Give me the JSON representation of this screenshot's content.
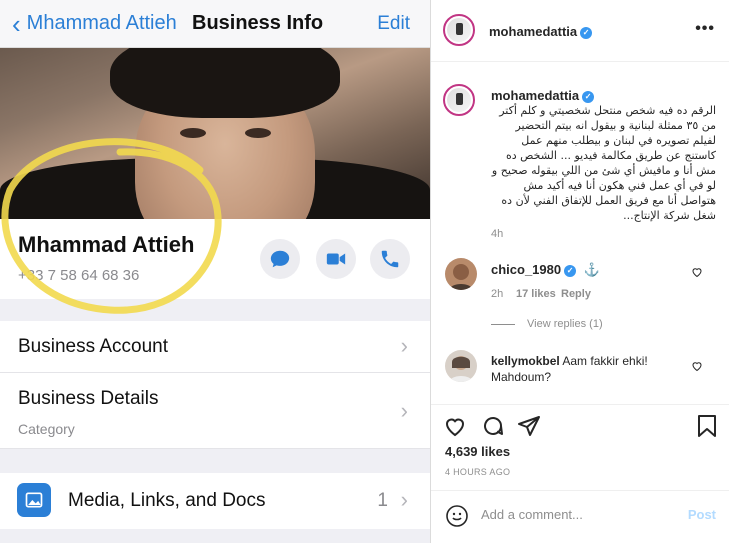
{
  "whatsapp": {
    "nav": {
      "back_label": "Mhammad Attieh",
      "title": "Business Info",
      "edit_label": "Edit"
    },
    "contact": {
      "name": "Mhammad Attieh",
      "phone": "+33 7 58 64 68 36"
    },
    "rows": [
      {
        "label": "Business Account"
      },
      {
        "label": "Business Details",
        "sub": "Category"
      }
    ],
    "media": {
      "label": "Media, Links, and Docs",
      "count": "1"
    },
    "colors": {
      "accent": "#2b7fd6",
      "highlight": "#f2d94e"
    }
  },
  "instagram": {
    "header": {
      "username": "mohamedattia"
    },
    "caption": {
      "username": "mohamedattia",
      "text": "الرقم ده فيه شخص منتحل شخصيتي و كلم أكتر من ٣٥ ممثلة لبنانية و بيقول انه بيتم التحضير لفيلم تصويره في لبنان و بيطلب منهم عمل كاستنج عن طريق مكالمة فيديو ... الشخص ده مش أنا و مافيش أي شئ من اللي بيقوله صحيح و لو في أي عمل فني هكون أنا فيه أكيد مش هتواصل أنا مع فريق العمل للإتفاق الفني لأن ده شغل شركة الإنتاج...",
      "time": "4h"
    },
    "comments": [
      {
        "username": "chico_1980",
        "text": "",
        "time": "2h",
        "likes": "17 likes",
        "reply": "Reply",
        "view_replies": "View replies (1)"
      },
      {
        "username": "kellymokbel",
        "text": "Aam fakkir ehki! Mahdoum?"
      }
    ],
    "likes": "4,639 likes",
    "posted": "4 HOURS AGO",
    "add_comment_placeholder": "Add a comment...",
    "post_label": "Post"
  }
}
